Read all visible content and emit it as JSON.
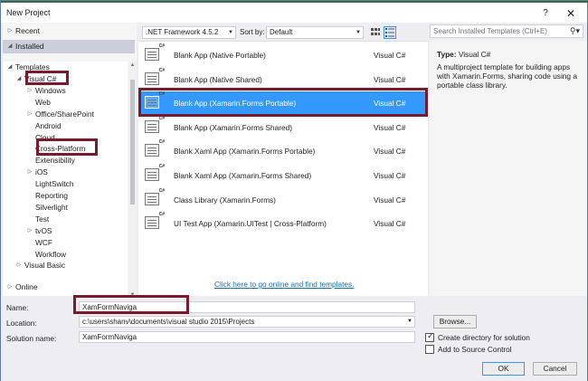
{
  "window": {
    "title": "New Project",
    "help_glyph": "?",
    "close_glyph": "✕"
  },
  "left_tree": {
    "recent_label": "Recent",
    "installed_label": "Installed",
    "templates_label": "Templates",
    "items": [
      {
        "label": "Visual C#",
        "indent": 1,
        "arrow": "◢"
      },
      {
        "label": "Windows",
        "indent": 2,
        "arrow": "▷"
      },
      {
        "label": "Web",
        "indent": 2,
        "arrow": ""
      },
      {
        "label": "Office/SharePoint",
        "indent": 2,
        "arrow": "▷"
      },
      {
        "label": "Android",
        "indent": 2,
        "arrow": ""
      },
      {
        "label": "Cloud",
        "indent": 2,
        "arrow": ""
      },
      {
        "label": "Cross-Platform",
        "indent": 2,
        "arrow": ""
      },
      {
        "label": "Extensibility",
        "indent": 2,
        "arrow": ""
      },
      {
        "label": "iOS",
        "indent": 2,
        "arrow": "▷"
      },
      {
        "label": "LightSwitch",
        "indent": 2,
        "arrow": ""
      },
      {
        "label": "Reporting",
        "indent": 2,
        "arrow": ""
      },
      {
        "label": "Silverlight",
        "indent": 2,
        "arrow": ""
      },
      {
        "label": "Test",
        "indent": 2,
        "arrow": ""
      },
      {
        "label": "tvOS",
        "indent": 2,
        "arrow": "▷"
      },
      {
        "label": "WCF",
        "indent": 2,
        "arrow": ""
      },
      {
        "label": "Workflow",
        "indent": 2,
        "arrow": ""
      },
      {
        "label": "Visual Basic",
        "indent": 1,
        "arrow": "▷"
      }
    ],
    "online_label": "Online"
  },
  "toolbar": {
    "framework": ".NET Framework 4.5.2",
    "sort_label": "Sort by:",
    "sort_value": "Default"
  },
  "templates": [
    {
      "name": "Blank App (Native Portable)",
      "lang": "Visual C#"
    },
    {
      "name": "Blank App (Native Shared)",
      "lang": "Visual C#"
    },
    {
      "name": "Blank App (Xamarin.Forms Portable)",
      "lang": "Visual C#"
    },
    {
      "name": "Blank App (Xamarin.Forms Shared)",
      "lang": "Visual C#"
    },
    {
      "name": "Blank Xaml App (Xamarin.Forms Portable)",
      "lang": "Visual C#"
    },
    {
      "name": "Blank Xaml App (Xamarin.Forms Shared)",
      "lang": "Visual C#"
    },
    {
      "name": "Class Library (Xamarin.Forms)",
      "lang": "Visual C#"
    },
    {
      "name": "UI Test App (Xamarin.UITest | Cross-Platform)",
      "lang": "Visual C#"
    }
  ],
  "online_link": "Click here to go online and find templates.",
  "search": {
    "placeholder": "Search Installed Templates (Ctrl+E)"
  },
  "description": {
    "type_label": "Type:",
    "type_value": "Visual C#",
    "text": "A multiproject template for building apps with Xamarin.Forms, sharing code using a portable class library."
  },
  "form": {
    "name_label": "Name:",
    "name_value": "XamFormNaviga",
    "location_label": "Location:",
    "location_value": "c:\\users\\shanv\\documents\\visual studio 2015\\Projects",
    "solution_label": "Solution name:",
    "solution_value": "XamFormNaviga",
    "browse_label": "Browse...",
    "create_dir_label": "Create directory for solution",
    "create_dir_checked": true,
    "source_control_label": "Add to Source Control",
    "source_control_checked": false,
    "ok_label": "OK",
    "cancel_label": "Cancel"
  },
  "colors": {
    "selection": "#3399ff",
    "highlight_border": "#7a1a2a",
    "link": "#0e70c0"
  }
}
